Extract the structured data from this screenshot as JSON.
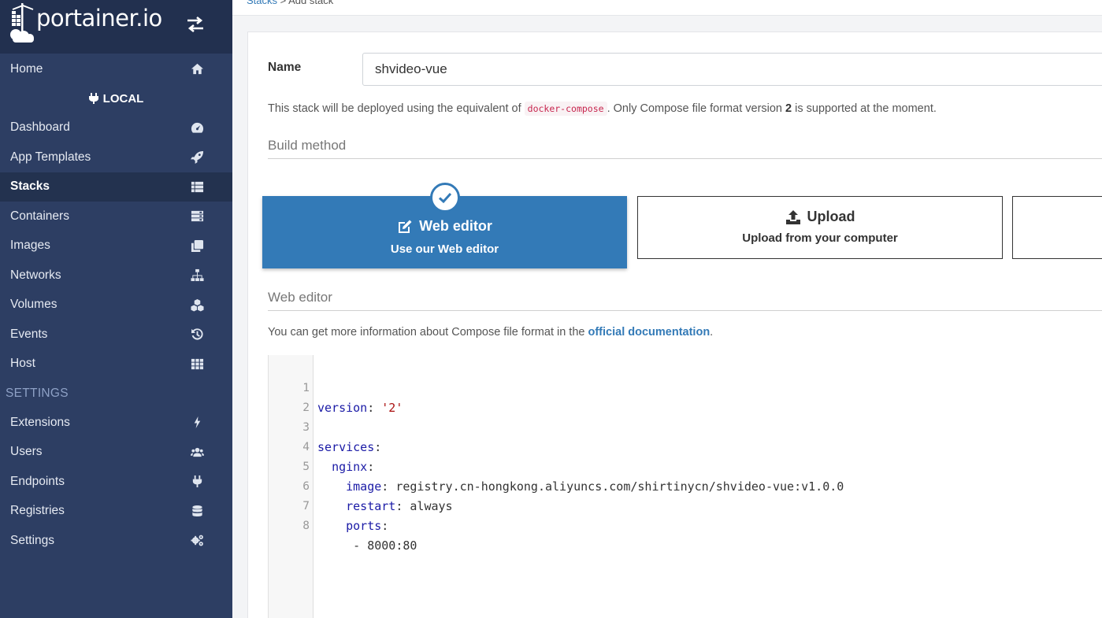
{
  "brand": {
    "name": "portainer.io"
  },
  "sidebar": {
    "items": [
      {
        "label": "Home",
        "icon": "home-icon"
      },
      {
        "label": "Dashboard",
        "icon": "dashboard-icon"
      },
      {
        "label": "App Templates",
        "icon": "rocket-icon"
      },
      {
        "label": "Stacks",
        "icon": "th-list-icon"
      },
      {
        "label": "Containers",
        "icon": "server-icon"
      },
      {
        "label": "Images",
        "icon": "clone-icon"
      },
      {
        "label": "Networks",
        "icon": "sitemap-icon"
      },
      {
        "label": "Volumes",
        "icon": "cubes-icon"
      },
      {
        "label": "Events",
        "icon": "history-icon"
      },
      {
        "label": "Host",
        "icon": "th-icon"
      }
    ],
    "environment": "LOCAL",
    "settings_title": "SETTINGS",
    "settings_items": [
      {
        "label": "Extensions",
        "icon": "bolt-icon"
      },
      {
        "label": "Users",
        "icon": "users-icon"
      },
      {
        "label": "Endpoints",
        "icon": "plug-icon"
      },
      {
        "label": "Registries",
        "icon": "database-icon"
      },
      {
        "label": "Settings",
        "icon": "cogs-icon"
      }
    ],
    "active": "Stacks"
  },
  "breadcrumb": {
    "parent": "Stacks",
    "sep": ">",
    "current": "Add stack"
  },
  "form": {
    "name_label": "Name",
    "name_value": "shvideo-vue",
    "info_prefix": "This stack will be deployed using the equivalent of ",
    "info_code": "docker-compose",
    "info_mid": ". Only Compose file format version ",
    "info_version": "2",
    "info_suffix": " is supported at the moment.",
    "build_method_title": "Build method",
    "methods": [
      {
        "title": "Web editor",
        "subtitle": "Use our Web editor",
        "selected": true
      },
      {
        "title": "Upload",
        "subtitle": "Upload from your computer",
        "selected": false
      }
    ],
    "web_editor_title": "Web editor",
    "doc_prefix": "You can get more information about Compose file format in the ",
    "doc_link": "official documentation",
    "doc_suffix": "."
  },
  "editor": {
    "lines": [
      {
        "n": "1",
        "key": "version",
        "value": "'2'",
        "indent": ""
      },
      {
        "n": "2",
        "key": "",
        "value": "",
        "indent": ""
      },
      {
        "n": "3",
        "key": "services",
        "value": "",
        "indent": ""
      },
      {
        "n": "4",
        "key": "nginx",
        "value": "",
        "indent": "  "
      },
      {
        "n": "5",
        "key": "image",
        "value": "registry.cn-hongkong.aliyuncs.com/shirtinycn/shvideo-vue:v1.0.0",
        "indent": "    "
      },
      {
        "n": "6",
        "key": "restart",
        "value": "always",
        "indent": "    "
      },
      {
        "n": "7",
        "key": "ports",
        "value": "",
        "indent": "    "
      },
      {
        "n": "8",
        "key": "",
        "value": "- 8000:80",
        "indent": "     "
      }
    ]
  },
  "colors": {
    "sidebar": "#2d3e63",
    "brand_bg": "#22304f",
    "primary": "#337ab7"
  }
}
